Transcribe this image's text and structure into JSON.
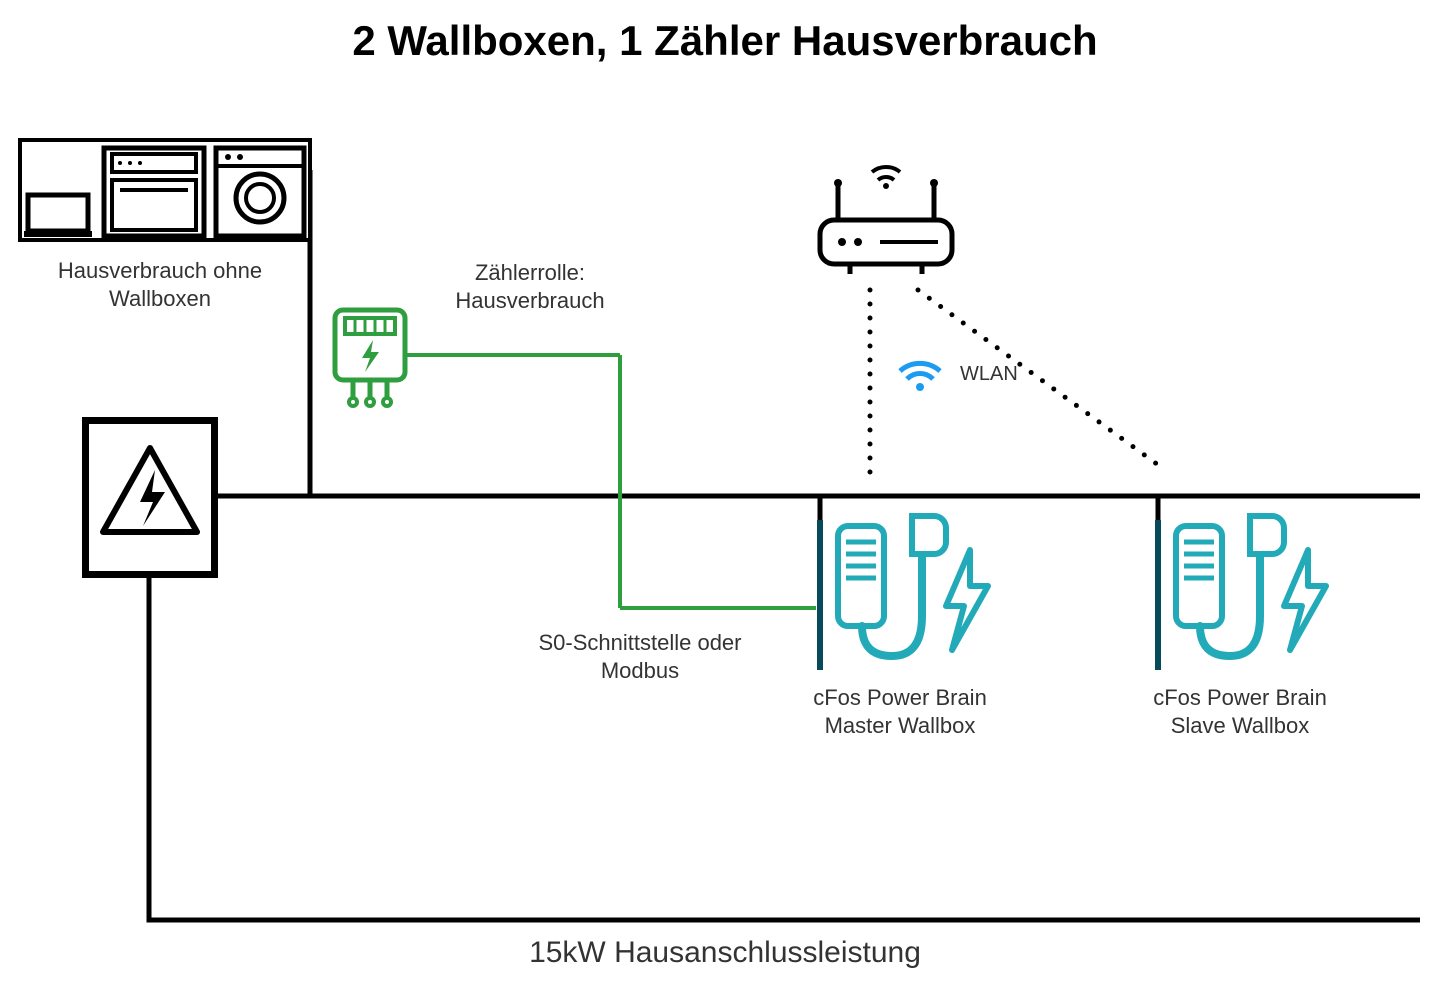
{
  "title": "2 Wallboxen, 1 Zähler Hausverbrauch",
  "labels": {
    "houseConsumption": [
      "Hausverbrauch ohne",
      "Wallboxen"
    ],
    "meterRole": [
      "Zählerrolle:",
      "Hausverbrauch"
    ],
    "interface": [
      "S0-Schnittstelle oder",
      "Modbus"
    ],
    "wlan": "WLAN",
    "masterWallbox": [
      "cFos Power Brain",
      "Master Wallbox"
    ],
    "slaveWallbox": [
      "cFos Power Brain",
      "Slave Wallbox"
    ],
    "bottom": "15kW Hausanschlussleistung"
  }
}
